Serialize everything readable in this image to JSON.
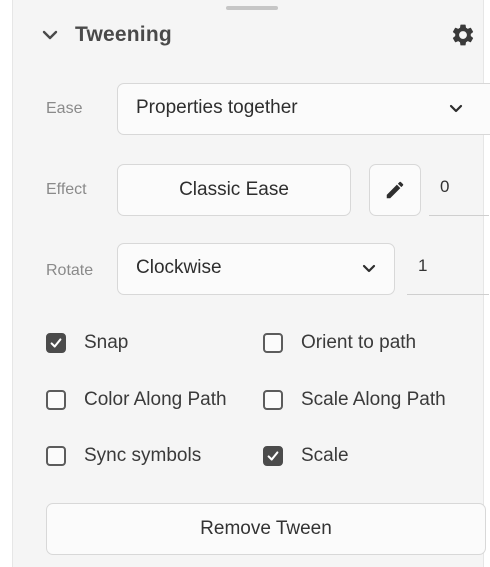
{
  "panel": {
    "title": "Tweening",
    "icons": {
      "collapse": "chevron-down-icon",
      "settings": "gear-icon"
    }
  },
  "ease": {
    "label": "Ease",
    "value": "Properties together"
  },
  "effect": {
    "label": "Effect",
    "button_label": "Classic Ease",
    "edit_icon": "pencil-icon",
    "value": "0"
  },
  "rotate": {
    "label": "Rotate",
    "value": "Clockwise",
    "count": "1"
  },
  "options": {
    "snap": {
      "label": "Snap",
      "checked": true
    },
    "orient_to_path": {
      "label": "Orient to path",
      "checked": false
    },
    "color_along_path": {
      "label": "Color Along Path",
      "checked": false
    },
    "scale_along_path": {
      "label": "Scale Along Path",
      "checked": false
    },
    "sync_symbols": {
      "label": "Sync symbols",
      "checked": false
    },
    "scale": {
      "label": "Scale",
      "checked": true
    }
  },
  "remove_button": {
    "label": "Remove Tween"
  }
}
